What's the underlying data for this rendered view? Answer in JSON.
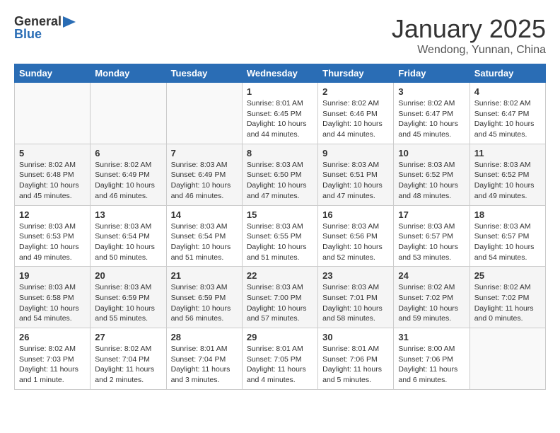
{
  "header": {
    "logo_line1": "General",
    "logo_line2": "Blue",
    "month_title": "January 2025",
    "location": "Wendong, Yunnan, China"
  },
  "weekdays": [
    "Sunday",
    "Monday",
    "Tuesday",
    "Wednesday",
    "Thursday",
    "Friday",
    "Saturday"
  ],
  "weeks": [
    [
      {
        "day": "",
        "info": ""
      },
      {
        "day": "",
        "info": ""
      },
      {
        "day": "",
        "info": ""
      },
      {
        "day": "1",
        "info": "Sunrise: 8:01 AM\nSunset: 6:45 PM\nDaylight: 10 hours\nand 44 minutes."
      },
      {
        "day": "2",
        "info": "Sunrise: 8:02 AM\nSunset: 6:46 PM\nDaylight: 10 hours\nand 44 minutes."
      },
      {
        "day": "3",
        "info": "Sunrise: 8:02 AM\nSunset: 6:47 PM\nDaylight: 10 hours\nand 45 minutes."
      },
      {
        "day": "4",
        "info": "Sunrise: 8:02 AM\nSunset: 6:47 PM\nDaylight: 10 hours\nand 45 minutes."
      }
    ],
    [
      {
        "day": "5",
        "info": "Sunrise: 8:02 AM\nSunset: 6:48 PM\nDaylight: 10 hours\nand 45 minutes."
      },
      {
        "day": "6",
        "info": "Sunrise: 8:02 AM\nSunset: 6:49 PM\nDaylight: 10 hours\nand 46 minutes."
      },
      {
        "day": "7",
        "info": "Sunrise: 8:03 AM\nSunset: 6:49 PM\nDaylight: 10 hours\nand 46 minutes."
      },
      {
        "day": "8",
        "info": "Sunrise: 8:03 AM\nSunset: 6:50 PM\nDaylight: 10 hours\nand 47 minutes."
      },
      {
        "day": "9",
        "info": "Sunrise: 8:03 AM\nSunset: 6:51 PM\nDaylight: 10 hours\nand 47 minutes."
      },
      {
        "day": "10",
        "info": "Sunrise: 8:03 AM\nSunset: 6:52 PM\nDaylight: 10 hours\nand 48 minutes."
      },
      {
        "day": "11",
        "info": "Sunrise: 8:03 AM\nSunset: 6:52 PM\nDaylight: 10 hours\nand 49 minutes."
      }
    ],
    [
      {
        "day": "12",
        "info": "Sunrise: 8:03 AM\nSunset: 6:53 PM\nDaylight: 10 hours\nand 49 minutes."
      },
      {
        "day": "13",
        "info": "Sunrise: 8:03 AM\nSunset: 6:54 PM\nDaylight: 10 hours\nand 50 minutes."
      },
      {
        "day": "14",
        "info": "Sunrise: 8:03 AM\nSunset: 6:54 PM\nDaylight: 10 hours\nand 51 minutes."
      },
      {
        "day": "15",
        "info": "Sunrise: 8:03 AM\nSunset: 6:55 PM\nDaylight: 10 hours\nand 51 minutes."
      },
      {
        "day": "16",
        "info": "Sunrise: 8:03 AM\nSunset: 6:56 PM\nDaylight: 10 hours\nand 52 minutes."
      },
      {
        "day": "17",
        "info": "Sunrise: 8:03 AM\nSunset: 6:57 PM\nDaylight: 10 hours\nand 53 minutes."
      },
      {
        "day": "18",
        "info": "Sunrise: 8:03 AM\nSunset: 6:57 PM\nDaylight: 10 hours\nand 54 minutes."
      }
    ],
    [
      {
        "day": "19",
        "info": "Sunrise: 8:03 AM\nSunset: 6:58 PM\nDaylight: 10 hours\nand 54 minutes."
      },
      {
        "day": "20",
        "info": "Sunrise: 8:03 AM\nSunset: 6:59 PM\nDaylight: 10 hours\nand 55 minutes."
      },
      {
        "day": "21",
        "info": "Sunrise: 8:03 AM\nSunset: 6:59 PM\nDaylight: 10 hours\nand 56 minutes."
      },
      {
        "day": "22",
        "info": "Sunrise: 8:03 AM\nSunset: 7:00 PM\nDaylight: 10 hours\nand 57 minutes."
      },
      {
        "day": "23",
        "info": "Sunrise: 8:03 AM\nSunset: 7:01 PM\nDaylight: 10 hours\nand 58 minutes."
      },
      {
        "day": "24",
        "info": "Sunrise: 8:02 AM\nSunset: 7:02 PM\nDaylight: 10 hours\nand 59 minutes."
      },
      {
        "day": "25",
        "info": "Sunrise: 8:02 AM\nSunset: 7:02 PM\nDaylight: 11 hours\nand 0 minutes."
      }
    ],
    [
      {
        "day": "26",
        "info": "Sunrise: 8:02 AM\nSunset: 7:03 PM\nDaylight: 11 hours\nand 1 minute."
      },
      {
        "day": "27",
        "info": "Sunrise: 8:02 AM\nSunset: 7:04 PM\nDaylight: 11 hours\nand 2 minutes."
      },
      {
        "day": "28",
        "info": "Sunrise: 8:01 AM\nSunset: 7:04 PM\nDaylight: 11 hours\nand 3 minutes."
      },
      {
        "day": "29",
        "info": "Sunrise: 8:01 AM\nSunset: 7:05 PM\nDaylight: 11 hours\nand 4 minutes."
      },
      {
        "day": "30",
        "info": "Sunrise: 8:01 AM\nSunset: 7:06 PM\nDaylight: 11 hours\nand 5 minutes."
      },
      {
        "day": "31",
        "info": "Sunrise: 8:00 AM\nSunset: 7:06 PM\nDaylight: 11 hours\nand 6 minutes."
      },
      {
        "day": "",
        "info": ""
      }
    ]
  ]
}
